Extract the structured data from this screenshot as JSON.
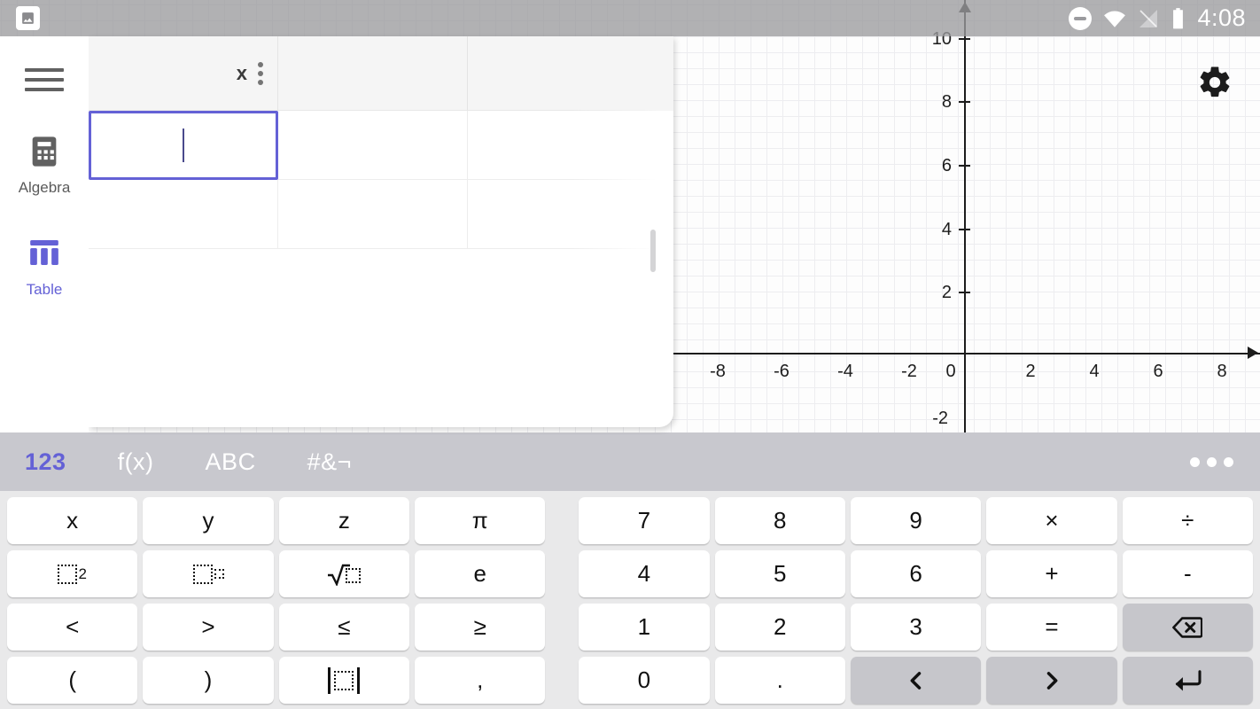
{
  "app": {
    "accent_color": "#6461d6",
    "toolbar_color": "#c8c8ce",
    "keyboard_bg": "#e9e9ea"
  },
  "statusbar": {
    "photo_icon": "image-icon",
    "dnd_icon": "do-not-disturb-icon",
    "wifi_icon": "wifi-icon",
    "signal_off_icon": "signal-off-icon",
    "battery_icon": "battery-icon",
    "clock": "4:08"
  },
  "sidebar": {
    "menu_icon": "hamburger-menu-icon",
    "items": [
      {
        "label": "Algebra",
        "icon": "calculator-icon",
        "active": false
      },
      {
        "label": "Table",
        "icon": "table-icon",
        "active": true
      }
    ]
  },
  "table_panel": {
    "columns": [
      {
        "header": "x",
        "has_menu": true
      },
      {
        "header": "",
        "has_menu": false
      },
      {
        "header": "",
        "has_menu": false
      }
    ],
    "rows": [
      {
        "cells": [
          "",
          "",
          ""
        ],
        "selected_index": 0
      },
      {
        "cells": [
          "",
          "",
          ""
        ],
        "selected_index": -1
      }
    ],
    "selected_cell_value": "",
    "scrollbar": "vertical-scrollbar"
  },
  "graph": {
    "gear_icon": "settings-gear-icon",
    "x_ticks": [
      "-8",
      "-6",
      "-4",
      "-2",
      "0",
      "2",
      "4",
      "6",
      "8"
    ],
    "y_ticks": [
      "10",
      "8",
      "6",
      "4",
      "2",
      "-2"
    ],
    "x_axis_label": "",
    "y_axis_label": ""
  },
  "chart_data": {
    "type": "scatter",
    "title": "",
    "xlabel": "",
    "ylabel": "",
    "xlim": [
      -9.2,
      9.3
    ],
    "ylim": [
      -2.6,
      10.6
    ],
    "xticks": [
      -8,
      -6,
      -4,
      -2,
      0,
      2,
      4,
      6,
      8
    ],
    "yticks": [
      -2,
      2,
      4,
      6,
      8,
      10
    ],
    "grid": true,
    "minor_grid": true,
    "minor_step": 0.25,
    "major_step": 1,
    "legend": "none",
    "series": [
      {
        "name": "",
        "x": [],
        "y": []
      }
    ]
  },
  "keyboard": {
    "tabs": [
      {
        "label": "123",
        "active": true
      },
      {
        "label": "f(x)",
        "active": false
      },
      {
        "label": "ABC",
        "active": false
      },
      {
        "label": "#&¬",
        "active": false
      }
    ],
    "more_icon": "more-options-icon",
    "left_rows": [
      [
        {
          "label": "x",
          "name": "key-x",
          "kind": "text"
        },
        {
          "label": "y",
          "name": "key-y",
          "kind": "text"
        },
        {
          "label": "z",
          "name": "key-z",
          "kind": "text"
        },
        {
          "label": "π",
          "name": "key-pi",
          "kind": "text"
        }
      ],
      [
        {
          "label": "□²",
          "name": "key-square",
          "kind": "square"
        },
        {
          "label": "□^□",
          "name": "key-power",
          "kind": "power"
        },
        {
          "label": "√□",
          "name": "key-sqrt",
          "kind": "sqrt"
        },
        {
          "label": "e",
          "name": "key-e",
          "kind": "text"
        }
      ],
      [
        {
          "label": "<",
          "name": "key-less-than",
          "kind": "text"
        },
        {
          "label": ">",
          "name": "key-greater-than",
          "kind": "text"
        },
        {
          "label": "≤",
          "name": "key-less-equal",
          "kind": "text"
        },
        {
          "label": "≥",
          "name": "key-greater-equal",
          "kind": "text"
        }
      ],
      [
        {
          "label": "(",
          "name": "key-open-paren",
          "kind": "text"
        },
        {
          "label": ")",
          "name": "key-close-paren",
          "kind": "text"
        },
        {
          "label": "|□|",
          "name": "key-absolute-value",
          "kind": "abs"
        },
        {
          "label": ",",
          "name": "key-comma",
          "kind": "text"
        }
      ]
    ],
    "right_rows": [
      [
        {
          "label": "7",
          "name": "key-7",
          "gray": false
        },
        {
          "label": "8",
          "name": "key-8",
          "gray": false
        },
        {
          "label": "9",
          "name": "key-9",
          "gray": false
        },
        {
          "label": "×",
          "name": "key-multiply",
          "gray": false
        },
        {
          "label": "÷",
          "name": "key-divide",
          "gray": false
        }
      ],
      [
        {
          "label": "4",
          "name": "key-4",
          "gray": false
        },
        {
          "label": "5",
          "name": "key-5",
          "gray": false
        },
        {
          "label": "6",
          "name": "key-6",
          "gray": false
        },
        {
          "label": "+",
          "name": "key-plus",
          "gray": false
        },
        {
          "label": "-",
          "name": "key-minus",
          "gray": false
        }
      ],
      [
        {
          "label": "1",
          "name": "key-1",
          "gray": false
        },
        {
          "label": "2",
          "name": "key-2",
          "gray": false
        },
        {
          "label": "3",
          "name": "key-3",
          "gray": false
        },
        {
          "label": "=",
          "name": "key-equals",
          "gray": false
        },
        {
          "label": "⌫",
          "name": "key-backspace",
          "gray": true,
          "icon": "backspace-icon"
        }
      ],
      [
        {
          "label": "0",
          "name": "key-0",
          "gray": false
        },
        {
          "label": ".",
          "name": "key-decimal-point",
          "gray": false
        },
        {
          "label": "‹",
          "name": "key-cursor-left",
          "gray": true,
          "icon": "chevron-left-icon"
        },
        {
          "label": "›",
          "name": "key-cursor-right",
          "gray": true,
          "icon": "chevron-right-icon"
        },
        {
          "label": "↵",
          "name": "key-enter",
          "gray": true,
          "icon": "enter-icon"
        }
      ]
    ]
  }
}
